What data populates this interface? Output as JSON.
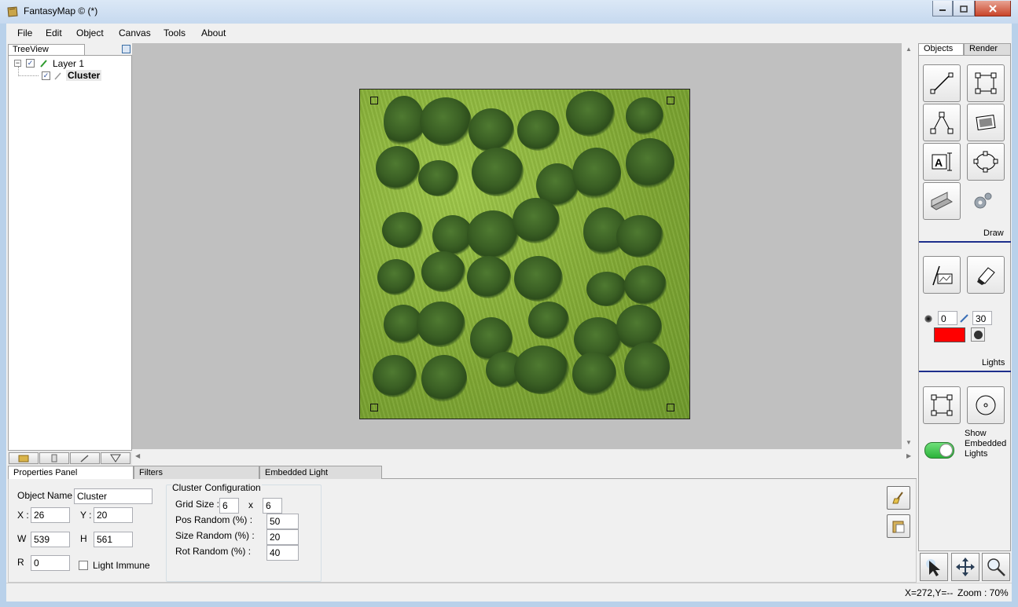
{
  "window": {
    "title": "FantasyMap © (*)",
    "minimize_label": "minimize",
    "maximize_label": "maximize",
    "close_label": "close"
  },
  "menu": [
    "File",
    "Edit",
    "Object",
    "Canvas",
    "Tools",
    "About"
  ],
  "treeview": {
    "tab": "TreeView",
    "nodes": [
      {
        "label": "Layer 1",
        "checked": true
      },
      {
        "label": "Cluster",
        "checked": true
      }
    ]
  },
  "bottom_tabs": [
    "Properties Panel",
    "Filters",
    "Embedded Light"
  ],
  "properties": {
    "object_name_label": "Object Name",
    "object_name": "Cluster",
    "x_label": "X :",
    "x": "26",
    "y_label": "Y :",
    "y": "20",
    "w_label": "W",
    "w": "539",
    "h_label": "H",
    "h": "561",
    "r_label": "R",
    "r": "0",
    "light_immune_label": "Light Immune",
    "light_immune": false
  },
  "cluster": {
    "title": "Cluster Configuration",
    "grid_size_label": "Grid Size :",
    "grid_x": "6",
    "grid_sep": "x",
    "grid_y": "6",
    "pos_random_label": "Pos Random (%) :",
    "pos_random": "50",
    "size_random_label": "Size Random (%) :",
    "size_random": "20",
    "rot_random_label": "Rot Random (%) :",
    "rot_random": "40"
  },
  "right_panel": {
    "tabs": [
      "Objects",
      "Render"
    ],
    "draw_label": "Draw",
    "lights_label": "Lights",
    "light_radius": "0",
    "light_brush": "30",
    "light_color": "#ff0000",
    "show_embedded_label": "Show Embedded Lights",
    "show_embedded": true
  },
  "status": {
    "coords": "X=272,Y=--",
    "zoom": "Zoom : 70%"
  },
  "icons": [
    "app-icon",
    "line-tool-icon",
    "rect-select-icon",
    "path-tool-icon",
    "image-tool-icon",
    "text-tool-icon",
    "ellipse-tool-icon",
    "texture-tool-icon",
    "settings-gear-icon",
    "light-paint-icon",
    "eraser-icon",
    "pointer-icon",
    "move-icon",
    "zoom-icon",
    "brush-clean-icon",
    "paste-icon"
  ]
}
